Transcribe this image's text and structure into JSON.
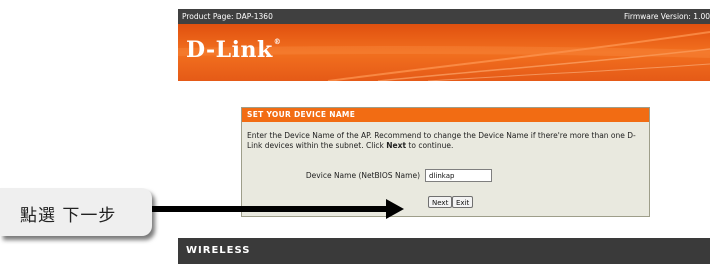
{
  "header": {
    "product_page": "Product Page: DAP-1360",
    "firmware_version": "Firmware Version: 1.00"
  },
  "banner": {
    "logo_text": "D-Link",
    "logo_mark": "®"
  },
  "panel": {
    "title": "SET YOUR DEVICE NAME",
    "description_part1": "Enter the Device Name of the AP. Recommend to change the Device Name if there're more than one D-Link devices within the subnet. Click ",
    "description_bold": "Next",
    "description_part2": " to continue.",
    "field_label": "Device Name (NetBIOS Name)",
    "field_value": "dlinkap",
    "next_label": "Next",
    "exit_label": "Exit"
  },
  "callout": {
    "text": "點選 下一步"
  },
  "footer": {
    "section_label": "WIRELESS"
  },
  "colors": {
    "accent_orange": "#f26c13",
    "dark_bar": "#404040",
    "panel_bg": "#e9e9df"
  }
}
